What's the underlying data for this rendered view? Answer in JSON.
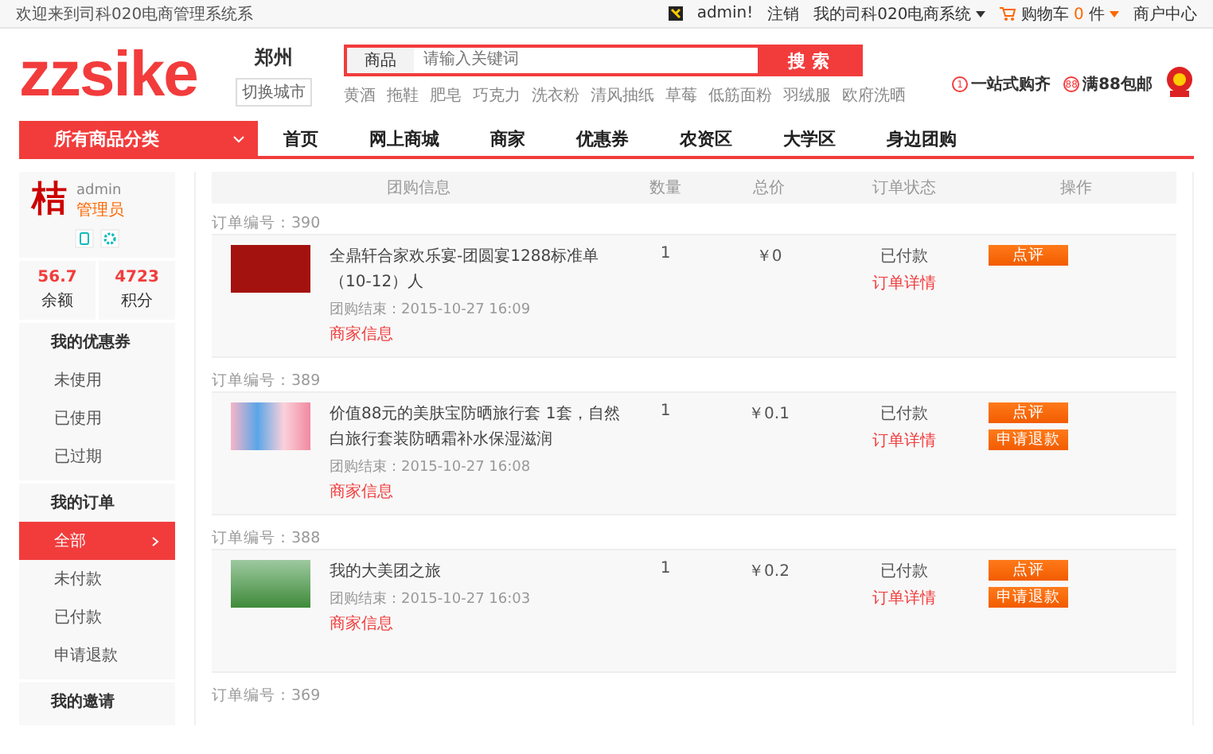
{
  "top_bar": {
    "welcome": "欢迎来到司科020电商管理系统系",
    "user": "admin!",
    "logout": "注销",
    "system_menu": "我的司科020电商系统",
    "cart_label": "购物车",
    "cart_count": "0",
    "cart_unit": "件",
    "merchant_center": "商户中心"
  },
  "header": {
    "logo": "zzsike",
    "city": "郑州",
    "switch_city": "切换城市",
    "search": {
      "category": "商品",
      "placeholder": "请输入关键词",
      "button": "搜 索"
    },
    "hot_words": [
      "黄酒",
      "拖鞋",
      "肥皂",
      "巧克力",
      "洗衣粉",
      "清风抽纸",
      "草莓",
      "低筋面粉",
      "羽绒服",
      "欧府洗晒"
    ],
    "promos": [
      {
        "badge": "1",
        "text": "一站式购齐"
      },
      {
        "badge": "88",
        "text": "满88包邮"
      }
    ]
  },
  "nav": {
    "category_button": "所有商品分类",
    "expanded": false,
    "items": [
      {
        "label": "首页",
        "selected": false
      },
      {
        "label": "网上商城",
        "selected": false
      },
      {
        "label": "商家",
        "selected": false
      },
      {
        "label": "优惠券",
        "selected": false
      },
      {
        "label": "农资区",
        "selected": false
      },
      {
        "label": "大学区",
        "selected": false
      },
      {
        "label": "身边团购",
        "selected": false
      }
    ]
  },
  "profile": {
    "avatar_char": "桔",
    "name": "admin",
    "role": "管理员",
    "balance": "56.7",
    "balance_label": "余额",
    "points": "4723",
    "points_label": "积分"
  },
  "sidebar": {
    "sections": [
      {
        "title": "我的优惠券",
        "items": [
          {
            "label": "未使用",
            "selected": false
          },
          {
            "label": "已使用",
            "selected": false
          },
          {
            "label": "已过期",
            "selected": false
          }
        ]
      },
      {
        "title": "我的订单",
        "items": [
          {
            "label": "全部",
            "selected": true
          },
          {
            "label": "未付款",
            "selected": false
          },
          {
            "label": "已付款",
            "selected": false
          },
          {
            "label": "申请退款",
            "selected": false
          }
        ]
      },
      {
        "title": "我的邀请"
      }
    ]
  },
  "table": {
    "columns": [
      "团购信息",
      "数量",
      "总价",
      "订单状态",
      "操作"
    ],
    "orders": [
      {
        "number": "订单编号：390",
        "title": "全鼎轩合家欢乐宴-团圆宴1288标准单（10-12）人",
        "end_time": "团购结束：2015-10-27 16:09",
        "merchant_link": "商家信息",
        "quantity": "1",
        "price": "￥0",
        "status": "已付款",
        "detail_link": "订单详情",
        "actions": [
          "点评"
        ]
      },
      {
        "number": "订单编号：389",
        "title": "价值88元的美肤宝防晒旅行套 1套，自然白旅行套装防晒霜补水保湿滋润",
        "end_time": "团购结束：2015-10-27 16:08",
        "merchant_link": "商家信息",
        "quantity": "1",
        "price": "￥0.1",
        "status": "已付款",
        "detail_link": "订单详情",
        "actions": [
          "点评",
          "申请退款"
        ]
      },
      {
        "number": "订单编号：388",
        "title": "我的大美团之旅",
        "end_time": "团购结束：2015-10-27 16:03",
        "merchant_link": "商家信息",
        "quantity": "1",
        "price": "￥0.2",
        "status": "已付款",
        "detail_link": "订单详情",
        "actions": [
          "点评",
          "申请退款"
        ]
      },
      {
        "number": "订单编号：369"
      }
    ]
  }
}
